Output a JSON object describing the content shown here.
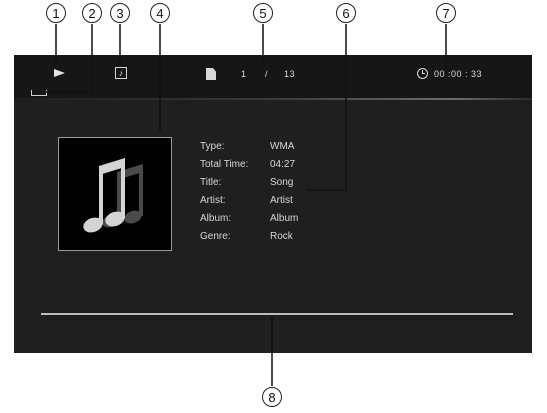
{
  "callouts": [
    "1",
    "2",
    "3",
    "4",
    "5",
    "6",
    "7",
    "8"
  ],
  "status_bar": {
    "play_state_icon": "play-icon",
    "repeat_icon": "repeat-icon",
    "mode_icon": "music-note-icon",
    "file_icon": "file-icon",
    "track_current": "1",
    "track_separator": "/",
    "track_total": "13",
    "clock_icon": "clock-icon",
    "elapsed_time": "00 :00 : 33"
  },
  "album_art": {
    "icon": "music-notes-icon"
  },
  "track_info": {
    "rows": [
      {
        "label": "Type:",
        "value": "WMA"
      },
      {
        "label": "Total Time:",
        "value": "04:27"
      },
      {
        "label": "Title:",
        "value": "Song"
      },
      {
        "label": "Artist:",
        "value": "Artist"
      },
      {
        "label": "Album:",
        "value": "Album"
      },
      {
        "label": "Genre:",
        "value": "Rock"
      }
    ]
  },
  "colors": {
    "screen_bg": "#1f1f1f",
    "topbar_bg": "#161616",
    "text": "#d8d8d8",
    "progress": "#bdbdbd"
  }
}
